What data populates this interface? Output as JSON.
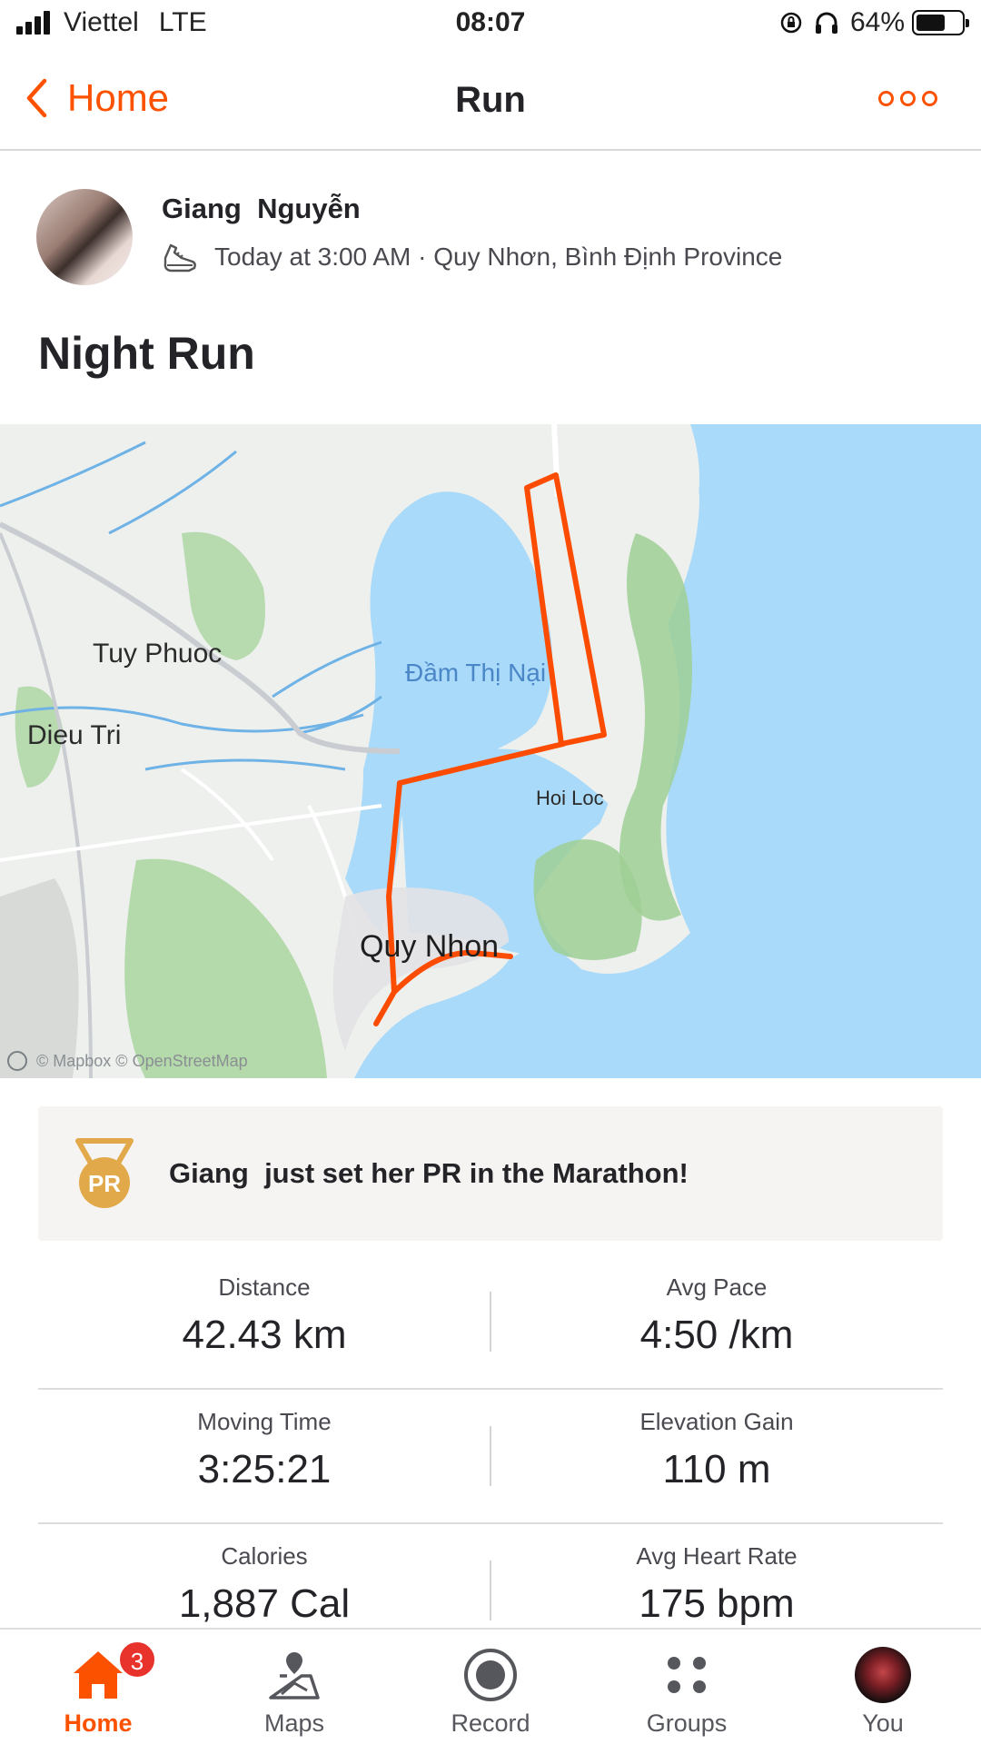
{
  "status_bar": {
    "carrier": "Viettel",
    "network": "LTE",
    "time": "08:07",
    "battery": "64%",
    "battery_level": 0.64
  },
  "nav": {
    "back_label": "Home",
    "title": "Run"
  },
  "activity": {
    "athlete_name": "Giang  Nguyễn",
    "meta": "Today at 3:00 AM · Quy Nhơn, Bình Định Province",
    "title": "Night Run",
    "sport_icon": "shoe-icon"
  },
  "map": {
    "labels": {
      "tuy_phuoc": "Tuy Phuoc",
      "dieu_tri": "Dieu Tri",
      "dam_thi_nai": "Đầm Thị Nại",
      "hoi_loc": "Hoi Loc",
      "quy_nhon": "Quy Nhon"
    },
    "attribution": "© Mapbox © OpenStreetMap",
    "route_color": "#fc4c02",
    "water_color": "#aadaf9"
  },
  "achievement": {
    "medal_text": "PR",
    "text": "Giang  just set her PR in the Marathon!"
  },
  "stats": [
    {
      "label": "Distance",
      "value": "42.43 km"
    },
    {
      "label": "Avg Pace",
      "value": "4:50 /km"
    },
    {
      "label": "Moving Time",
      "value": "3:25:21"
    },
    {
      "label": "Elevation Gain",
      "value": "110 m"
    },
    {
      "label": "Calories",
      "value": "1,887 Cal"
    },
    {
      "label": "Avg Heart Rate",
      "value": "175 bpm"
    }
  ],
  "tabs": [
    {
      "label": "Home",
      "badge": "3"
    },
    {
      "label": "Maps"
    },
    {
      "label": "Record"
    },
    {
      "label": "Groups"
    },
    {
      "label": "You"
    }
  ],
  "colors": {
    "accent": "#fc5200",
    "badge": "#e8322c"
  }
}
